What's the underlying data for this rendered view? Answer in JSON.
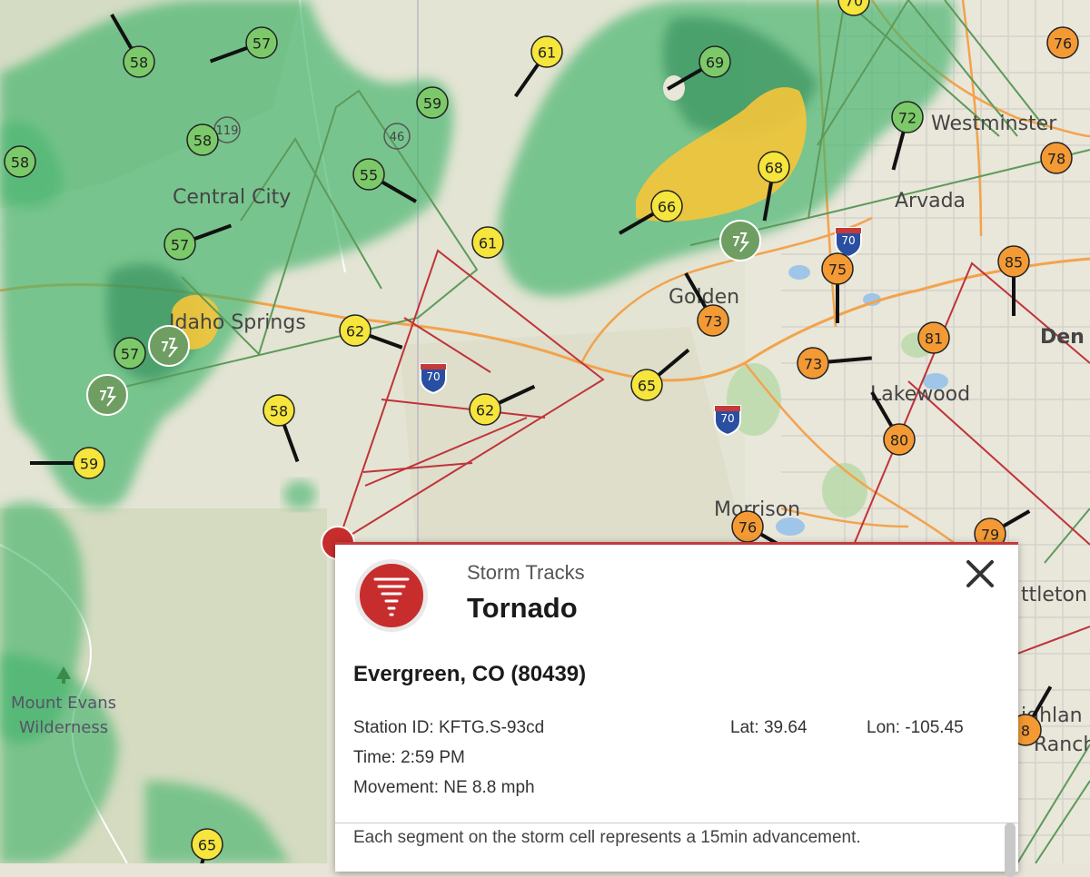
{
  "map": {
    "places": [
      {
        "name": "Central City"
      },
      {
        "name": "Idaho Springs"
      },
      {
        "name": "Golden"
      },
      {
        "name": "Arvada"
      },
      {
        "name": "Westminster"
      },
      {
        "name": "Lakewood"
      },
      {
        "name": "Morrison"
      },
      {
        "name": "Den"
      },
      {
        "name": "ttleton"
      },
      {
        "name": "ighlan"
      },
      {
        "name": "Ranch"
      }
    ],
    "wilderness": {
      "line1": "Mount Evans",
      "line2": "Wilderness"
    },
    "highway_shields": [
      {
        "label": "70"
      },
      {
        "label": "70"
      },
      {
        "label": "70"
      }
    ],
    "route_badges": [
      {
        "label": "119"
      },
      {
        "label": "46"
      }
    ],
    "colors": {
      "rain_green": "#3fb36a",
      "rain_yellow": "#f5c53a",
      "track_red": "#c0333a",
      "track_green": "#5c9a5a",
      "station_green": "#7cc96a",
      "station_yellow": "#f5e53c",
      "station_orange": "#f39a34"
    },
    "stations": [
      {
        "value": "58",
        "color": "green"
      },
      {
        "value": "57",
        "color": "green"
      },
      {
        "value": "58",
        "color": "green"
      },
      {
        "value": "58",
        "color": "green"
      },
      {
        "value": "57",
        "color": "green"
      },
      {
        "value": "57",
        "color": "green"
      },
      {
        "value": "59",
        "color": "green"
      },
      {
        "value": "55",
        "color": "green"
      },
      {
        "value": "69",
        "color": "green"
      },
      {
        "value": "72",
        "color": "green"
      },
      {
        "value": "61",
        "color": "yellow"
      },
      {
        "value": "61",
        "color": "yellow"
      },
      {
        "value": "62",
        "color": "yellow"
      },
      {
        "value": "58",
        "color": "yellow"
      },
      {
        "value": "62",
        "color": "yellow"
      },
      {
        "value": "65",
        "color": "yellow"
      },
      {
        "value": "59",
        "color": "yellow"
      },
      {
        "value": "65",
        "color": "yellow"
      },
      {
        "value": "66",
        "color": "yellow"
      },
      {
        "value": "68",
        "color": "yellow"
      },
      {
        "value": "70",
        "color": "yellow"
      },
      {
        "value": "73",
        "color": "orange"
      },
      {
        "value": "73",
        "color": "orange"
      },
      {
        "value": "75",
        "color": "orange"
      },
      {
        "value": "80",
        "color": "orange"
      },
      {
        "value": "81",
        "color": "orange"
      },
      {
        "value": "85",
        "color": "orange"
      },
      {
        "value": "78",
        "color": "orange"
      },
      {
        "value": "76",
        "color": "orange"
      },
      {
        "value": "76",
        "color": "orange"
      },
      {
        "value": "79",
        "color": "orange"
      },
      {
        "value": "8",
        "color": "orange"
      }
    ]
  },
  "popup": {
    "subtitle": "Storm Tracks",
    "title": "Tornado",
    "location": "Evergreen, CO (80439)",
    "station_id": "Station ID: KFTG.S-93cd",
    "lat": "Lat: 39.64",
    "lon": "Lon: -105.45",
    "time": "Time: 2:59 PM",
    "movement": "Movement: NE 8.8 mph",
    "note": "Each segment on the storm cell represents a 15min advancement.",
    "icons": {
      "storm": "tornado-icon",
      "close": "close-icon"
    }
  }
}
